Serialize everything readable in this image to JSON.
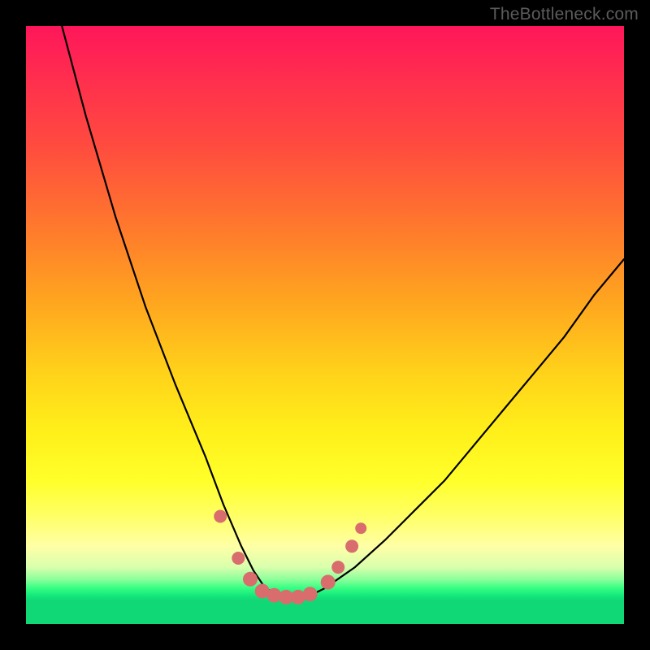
{
  "watermark": "TheBottleneck.com",
  "chart_data": {
    "type": "line",
    "title": "",
    "xlabel": "",
    "ylabel": "",
    "xlim": [
      0,
      100
    ],
    "ylim": [
      0,
      100
    ],
    "grid": false,
    "series": [
      {
        "name": "bottleneck-curve",
        "x": [
          6,
          10,
          15,
          20,
          25,
          30,
          33,
          36,
          38,
          40,
          42,
          44,
          46,
          48,
          50,
          55,
          60,
          65,
          70,
          75,
          80,
          85,
          90,
          95,
          100
        ],
        "values": [
          100,
          85,
          68,
          53,
          40,
          28,
          20,
          13,
          9,
          6,
          5,
          4.5,
          4.5,
          5,
          6,
          9.5,
          14,
          19,
          24,
          30,
          36,
          42,
          48,
          55,
          61
        ]
      }
    ],
    "markers": {
      "name": "highlight-points",
      "color": "#d96d6d",
      "points": [
        {
          "x": 32.5,
          "y": 18,
          "r": 8
        },
        {
          "x": 35.5,
          "y": 11,
          "r": 8
        },
        {
          "x": 37.5,
          "y": 7.5,
          "r": 9
        },
        {
          "x": 39.5,
          "y": 5.5,
          "r": 9
        },
        {
          "x": 41.5,
          "y": 4.8,
          "r": 9
        },
        {
          "x": 43.5,
          "y": 4.5,
          "r": 9
        },
        {
          "x": 45.5,
          "y": 4.5,
          "r": 9
        },
        {
          "x": 47.5,
          "y": 5,
          "r": 9
        },
        {
          "x": 50.5,
          "y": 7,
          "r": 9
        },
        {
          "x": 52.2,
          "y": 9.5,
          "r": 8
        },
        {
          "x": 54.5,
          "y": 13,
          "r": 8
        },
        {
          "x": 56,
          "y": 16,
          "r": 7
        }
      ]
    }
  }
}
